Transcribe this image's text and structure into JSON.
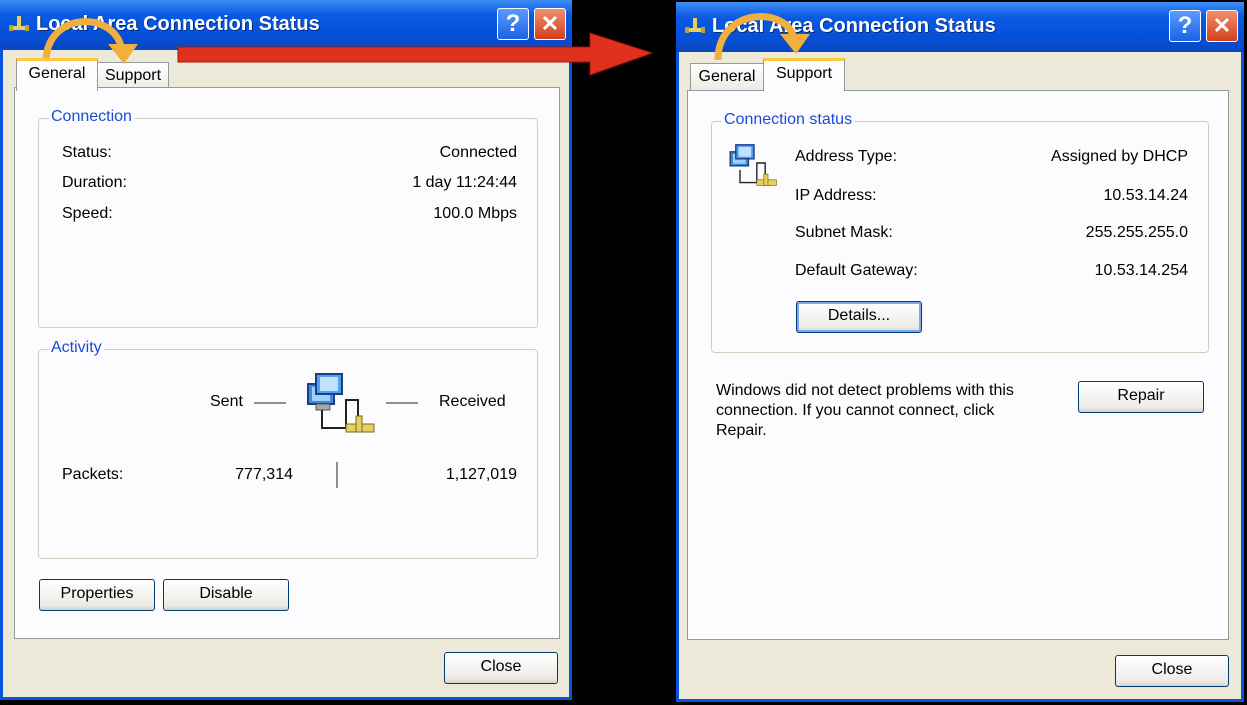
{
  "left_window": {
    "title": "Local Area Connection Status",
    "help_label": "?",
    "close_x": "✕",
    "tabs": [
      "General",
      "Support"
    ],
    "connection": {
      "group_title": "Connection",
      "rows": [
        {
          "label": "Status:",
          "value": "Connected"
        },
        {
          "label": "Duration:",
          "value": "1 day 11:24:44"
        },
        {
          "label": "Speed:",
          "value": "100.0 Mbps"
        }
      ]
    },
    "activity": {
      "group_title": "Activity",
      "sent_label": "Sent",
      "received_label": "Received",
      "packets_label": "Packets:",
      "packets_sent": "777,314",
      "packets_received": "1,127,019"
    },
    "properties_label": "Properties",
    "disable_label": "Disable",
    "close_label": "Close"
  },
  "right_window": {
    "title": "Local Area Connection Status",
    "help_label": "?",
    "close_x": "✕",
    "tabs": [
      "General",
      "Support"
    ],
    "connection_status": {
      "group_title": "Connection status",
      "rows": [
        {
          "label": "Address Type:",
          "value": "Assigned by DHCP"
        },
        {
          "label": "IP Address:",
          "value": "10.53.14.24"
        },
        {
          "label": "Subnet Mask:",
          "value": "255.255.255.0"
        },
        {
          "label": "Default Gateway:",
          "value": "10.53.14.254"
        }
      ],
      "details_label": "Details..."
    },
    "message": "Windows did not detect problems with this connection. If you cannot connect, click Repair.",
    "repair_label": "Repair",
    "close_label": "Close"
  },
  "colors": {
    "titlebar": "#0a5ae4",
    "dialog_bg": "#ece9d8",
    "group_title": "#1b4bd6",
    "annotation_arrow": "#e0301e",
    "annotation_curve": "#f0b040"
  },
  "icons": [
    "network-connection-icon",
    "computers-network-icon",
    "help-icon",
    "close-icon"
  ]
}
